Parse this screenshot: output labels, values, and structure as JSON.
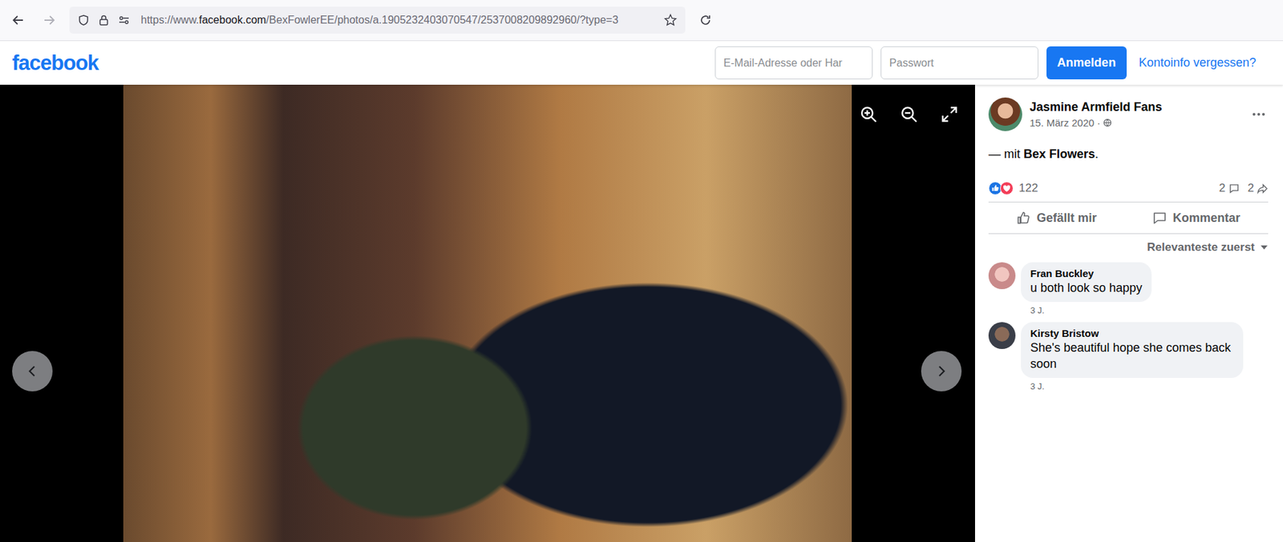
{
  "browser": {
    "url_scheme": "https://www.",
    "url_host": "facebook.com",
    "url_path": "/BexFowlerEE/photos/a.1905232403070547/2537008209892960/?type=3",
    "bookmarked": false
  },
  "header": {
    "logo": "facebook",
    "email_placeholder": "E-Mail-Adresse oder Har",
    "password_placeholder": "Passwort",
    "login_button": "Anmelden",
    "forgot_link": "Kontoinfo vergessen?"
  },
  "post": {
    "page_name": "Jasmine Armfield Fans",
    "date": "15. März 2020 ·",
    "caption_prefix": "— mit",
    "tagged": "Bex Flowers",
    "caption_suffix": ".",
    "reactions_count": "122",
    "comments_count": "2",
    "shares_count": "2",
    "actions": [
      {
        "label": "Gefällt mir",
        "kind": "like"
      },
      {
        "label": "Kommentar",
        "kind": "comment"
      }
    ],
    "sort": "Relevanteste zuerst"
  },
  "comments": [
    {
      "author": "Fran Buckley",
      "text": "u both look so happy",
      "time": "3 J."
    },
    {
      "author": "Kirsty Bristow",
      "text": "She's beautiful hope she comes back soon",
      "time": "3 J."
    }
  ]
}
